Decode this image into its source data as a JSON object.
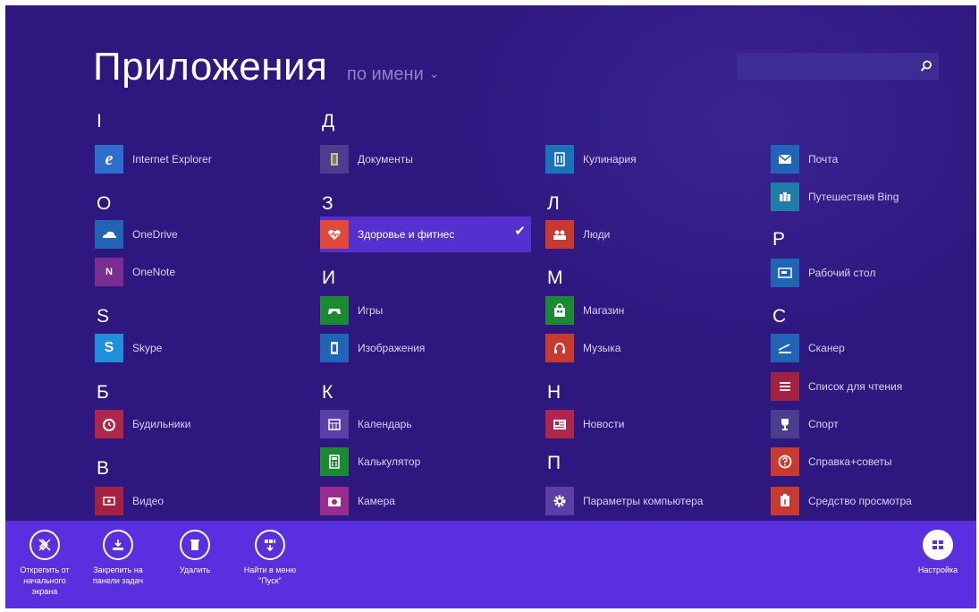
{
  "header": {
    "title": "Приложения",
    "sort_label": "по имени",
    "search_placeholder": ""
  },
  "colors": {
    "background": "#2e1880",
    "appbar": "#5a2fe0",
    "selected": "#5630cf"
  },
  "columns": [
    {
      "groups": [
        {
          "letter": "I",
          "apps": [
            {
              "name": "Internet Explorer",
              "icon": "internet-explorer-icon",
              "color": "#2d6fcc"
            }
          ]
        },
        {
          "letter": "O",
          "apps": [
            {
              "name": "OneDrive",
              "icon": "onedrive-icon",
              "color": "#1f64b5"
            },
            {
              "name": "OneNote",
              "icon": "onenote-icon",
              "color": "#7a2e92"
            }
          ]
        },
        {
          "letter": "S",
          "apps": [
            {
              "name": "Skype",
              "icon": "skype-icon",
              "color": "#1e8fdb"
            }
          ]
        },
        {
          "letter": "Б",
          "apps": [
            {
              "name": "Будильники",
              "icon": "alarm-clock-icon",
              "color": "#b0264a"
            }
          ]
        },
        {
          "letter": "В",
          "apps": [
            {
              "name": "Видео",
              "icon": "video-icon",
              "color": "#a32242"
            }
          ]
        }
      ]
    },
    {
      "groups": [
        {
          "letter": "Д",
          "apps": [
            {
              "name": "Документы",
              "icon": "documents-icon",
              "color": "#4c3d8f"
            }
          ]
        },
        {
          "letter": "З",
          "apps": [
            {
              "name": "Здоровье и фитнес",
              "icon": "health-fitness-icon",
              "color": "#e1493a",
              "selected": true
            }
          ]
        },
        {
          "letter": "И",
          "apps": [
            {
              "name": "Игры",
              "icon": "games-icon",
              "color": "#1b8a32"
            },
            {
              "name": "Изображения",
              "icon": "photos-icon",
              "color": "#1f64b5"
            }
          ]
        },
        {
          "letter": "К",
          "apps": [
            {
              "name": "Календарь",
              "icon": "calendar-icon",
              "color": "#5b3ea6"
            },
            {
              "name": "Калькулятор",
              "icon": "calculator-icon",
              "color": "#1b8a32"
            },
            {
              "name": "Камера",
              "icon": "camera-icon",
              "color": "#9a2b8f"
            }
          ]
        }
      ]
    },
    {
      "groups": [
        {
          "letter": "",
          "apps": [
            {
              "name": "Кулинария",
              "icon": "food-icon",
              "color": "#1a72b8"
            }
          ]
        },
        {
          "letter": "Л",
          "apps": [
            {
              "name": "Люди",
              "icon": "people-icon",
              "color": "#c8392e"
            }
          ]
        },
        {
          "letter": "М",
          "apps": [
            {
              "name": "Магазин",
              "icon": "store-icon",
              "color": "#1b8a32"
            },
            {
              "name": "Музыка",
              "icon": "music-icon",
              "color": "#c8392e"
            }
          ]
        },
        {
          "letter": "Н",
          "apps": [
            {
              "name": "Новости",
              "icon": "news-icon",
              "color": "#b0264a"
            }
          ]
        },
        {
          "letter": "П",
          "apps": [
            {
              "name": "Параметры компьютера",
              "icon": "settings-gear-icon",
              "color": "#5b3ea6"
            }
          ]
        }
      ]
    },
    {
      "groups": [
        {
          "letter": "",
          "apps": [
            {
              "name": "Почта",
              "icon": "mail-icon",
              "color": "#1f64b5"
            },
            {
              "name": "Путешествия Bing",
              "icon": "travel-icon",
              "color": "#1d7fa8"
            }
          ]
        },
        {
          "letter": "Р",
          "apps": [
            {
              "name": "Рабочий стол",
              "icon": "desktop-icon",
              "color": "#1f64b5"
            }
          ]
        },
        {
          "letter": "С",
          "apps": [
            {
              "name": "Сканер",
              "icon": "scanner-icon",
              "color": "#1f64b5"
            },
            {
              "name": "Список для чтения",
              "icon": "reading-list-icon",
              "color": "#a32242"
            },
            {
              "name": "Спорт",
              "icon": "sport-trophy-icon",
              "color": "#4c3d8f"
            },
            {
              "name": "Справка+советы",
              "icon": "help-tips-icon",
              "color": "#c8392e"
            },
            {
              "name": "Средство просмотра",
              "icon": "reader-icon",
              "color": "#c8392e"
            }
          ]
        }
      ]
    }
  ],
  "appbar": {
    "unpin_start": "Открепить от начального экрана",
    "pin_taskbar": "Закрепить на панели задач",
    "uninstall": "Удалить",
    "find_start": "Найти в меню \"Пуск\"",
    "customize": "Настройка"
  }
}
